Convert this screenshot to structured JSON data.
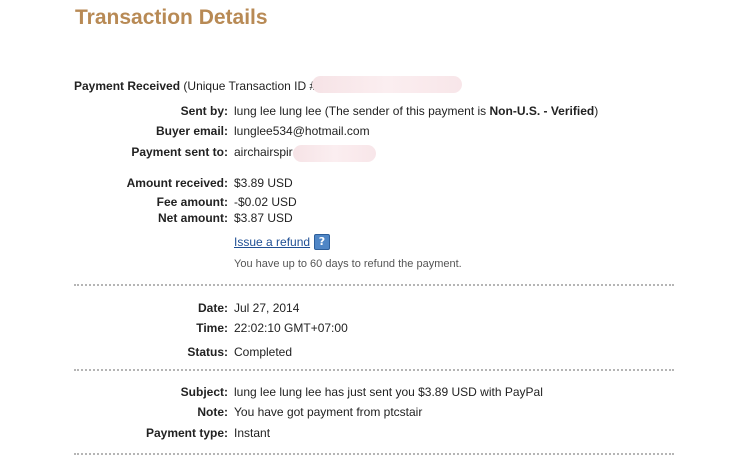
{
  "page_title": "Transaction Details",
  "payment_received": {
    "label": "Payment Received",
    "text": "(Unique Transaction ID #"
  },
  "sender": {
    "sent_by_label": "Sent by:",
    "sent_by_name": "lung lee lung lee",
    "sent_by_note_prefix": "(The sender of this payment is",
    "sent_by_status": "Non-U.S. - Verified",
    "sent_by_note_suffix": ")",
    "buyer_email_label": "Buyer email:",
    "buyer_email": "lunglee534@hotmail.com",
    "sent_to_label": "Payment sent to:",
    "sent_to": "airchairspir"
  },
  "amounts": {
    "received_label": "Amount received:",
    "received": "$3.89 USD",
    "fee_label": "Fee amount:",
    "fee": "-$0.02 USD",
    "net_label": "Net amount:",
    "net": "$3.87 USD",
    "refund_link": "Issue a refund",
    "help_icon": "?",
    "refund_note": "You have up to 60 days to refund the payment."
  },
  "details": {
    "date_label": "Date:",
    "date": "Jul 27, 2014",
    "time_label": "Time:",
    "time": "22:02:10 GMT+07:00",
    "status_label": "Status:",
    "status": "Completed"
  },
  "message": {
    "subject_label": "Subject:",
    "subject": "lung lee lung lee has just sent you $3.89 USD with PayPal",
    "note_label": "Note:",
    "note": "You have got payment from ptcstair",
    "payment_type_label": "Payment type:",
    "payment_type": "Instant"
  },
  "colors": {
    "title": "#b88a55",
    "link": "#1f4f94",
    "help_icon": "#4f86c6"
  }
}
